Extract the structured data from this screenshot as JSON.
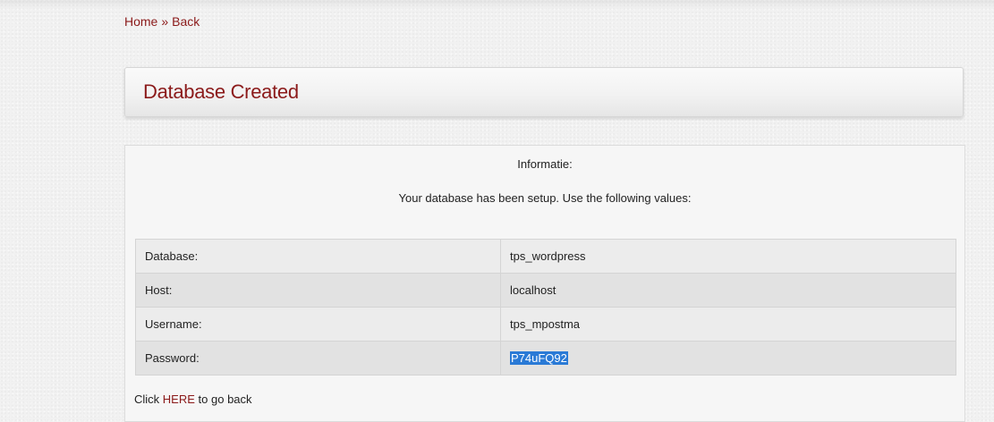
{
  "breadcrumb": {
    "home": "Home",
    "separator": "»",
    "back": "Back"
  },
  "page_title": "Database Created",
  "info": {
    "heading": "Informatie:",
    "message": "Your database has been setup. Use the following values:"
  },
  "values": [
    {
      "label": "Database:",
      "value": "tps_wordpress"
    },
    {
      "label": "Host:",
      "value": "localhost"
    },
    {
      "label": "Username:",
      "value": "tps_mpostma"
    },
    {
      "label": "Password:",
      "value": "P74uFQ92"
    }
  ],
  "footer": {
    "prefix": "Click",
    "link": "HERE",
    "suffix": "to go back"
  },
  "colors": {
    "accent": "#8b1a1a",
    "selection": "#2a7ad6"
  }
}
